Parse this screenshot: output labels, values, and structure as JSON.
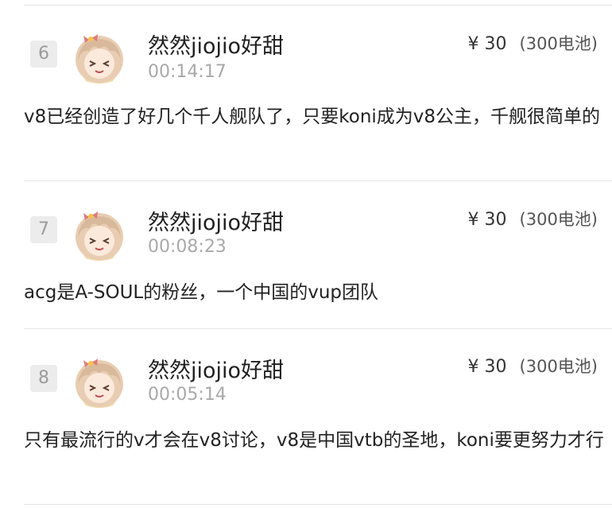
{
  "entries": [
    {
      "rank": "6",
      "username": "然然jiojio好甜",
      "time": "00:14:17",
      "amount": "¥ 30",
      "battery": "(300电池)",
      "message": "v8已经创造了好几个千人舰队了，只要koni成为v8公主，千舰很简单的"
    },
    {
      "rank": "7",
      "username": "然然jiojio好甜",
      "time": "00:08:23",
      "amount": "¥ 30",
      "battery": "(300电池)",
      "message": "acg是A-SOUL的粉丝，一个中国的vup团队"
    },
    {
      "rank": "8",
      "username": "然然jiojio好甜",
      "time": "00:05:14",
      "amount": "¥ 30",
      "battery": "(300电池)",
      "message": "只有最流行的v才会在v8讨论，v8是中国vtb的圣地，koni要更努力才行"
    }
  ],
  "colors": {
    "rank_bg": "#ececec",
    "rank_text": "#9b9b9b",
    "divider": "#e4e4e4",
    "time_text": "#a9a9a9",
    "avatar_hair": "#d9b99b",
    "avatar_bow": "#e07a7a"
  },
  "icons": {
    "avatar": "anime-girl-avatar-icon"
  }
}
